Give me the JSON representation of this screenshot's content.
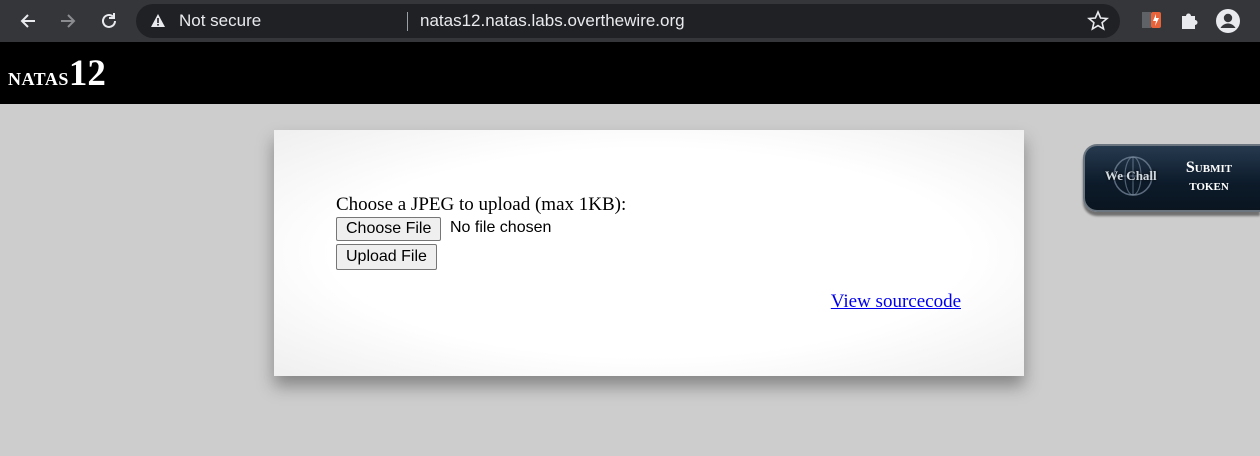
{
  "browser": {
    "security_label": "Not secure",
    "url": "natas12.natas.labs.overthewire.org",
    "icons": [
      "back-arrow-icon",
      "forward-arrow-icon",
      "reload-icon",
      "warning-icon",
      "bookmark-star-icon",
      "extension-icon",
      "puzzle-icon",
      "profile-icon"
    ]
  },
  "header": {
    "logo_word": "natas",
    "logo_number": "12"
  },
  "content": {
    "upload_prompt": "Choose a JPEG to upload (max 1KB):",
    "choose_file_label": "Choose File",
    "no_file_text": "No file chosen",
    "upload_button_label": "Upload File",
    "view_source_label": "View sourcecode"
  },
  "wechall": {
    "brand": "We Chall",
    "line1": "Submit",
    "line2": "token"
  },
  "colors": {
    "page_bg": "#cdcdcd",
    "header_bg": "#000000",
    "link": "#0000ee",
    "chrome_bg": "#35363a",
    "omnibox_bg": "#202124"
  }
}
